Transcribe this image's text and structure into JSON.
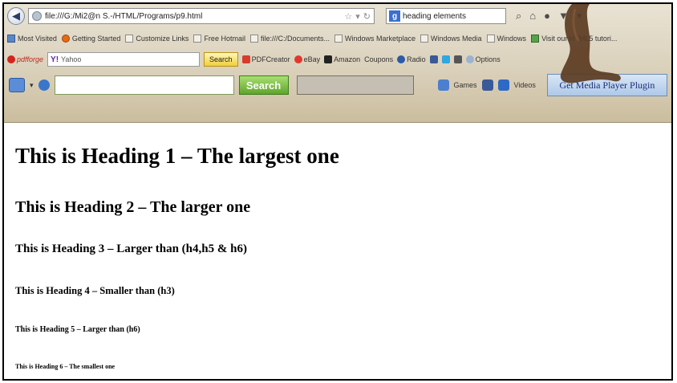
{
  "navbar": {
    "url": "file:///G:/Mi2@n S.-/HTML/Programs/p9.html",
    "search_query": "heading elements",
    "search_engine_icon": "google-icon"
  },
  "bookmarks": [
    {
      "label": "Most Visited",
      "icon": "star-icon"
    },
    {
      "label": "Getting Started",
      "icon": "firefox-icon"
    },
    {
      "label": "Customize Links",
      "icon": "page-icon"
    },
    {
      "label": "Free Hotmail",
      "icon": "page-icon"
    },
    {
      "label": "file:///C:/Documents...",
      "icon": "page-icon"
    },
    {
      "label": "Windows Marketplace",
      "icon": "page-icon"
    },
    {
      "label": "Windows Media",
      "icon": "page-icon"
    },
    {
      "label": "Windows",
      "icon": "page-icon"
    },
    {
      "label": "Visit our HTML5 tutori...",
      "icon": "html5-icon"
    }
  ],
  "yahoo_toolbar": {
    "brand": "pdfforge",
    "yahoo_prefix": "Y!",
    "search_placeholder": "Yahoo",
    "search_button": "Search",
    "items": [
      "PDFCreator",
      "eBay",
      "Amazon",
      "Coupons",
      "Radio",
      "Options"
    ]
  },
  "media_toolbar": {
    "search_button": "Search",
    "links": [
      "Games",
      "Videos"
    ],
    "plugin_button": "Get Media Player Plugin"
  },
  "page": {
    "h1": "This is Heading 1 – The largest one",
    "h2": "This is Heading 2 – The larger one",
    "h3": "This is Heading 3 – Larger than (h4,h5 & h6)",
    "h4": "This is Heading 4 – Smaller than (h3)",
    "h5": "This is Heading 5 – Larger than (h6)",
    "h6": "This is Heading 6 – The smallest one"
  },
  "colors": {
    "chrome_bg": "#d9cfb9",
    "plugin_text": "#1b2f7a",
    "media_search_green": "#5fa52c"
  }
}
